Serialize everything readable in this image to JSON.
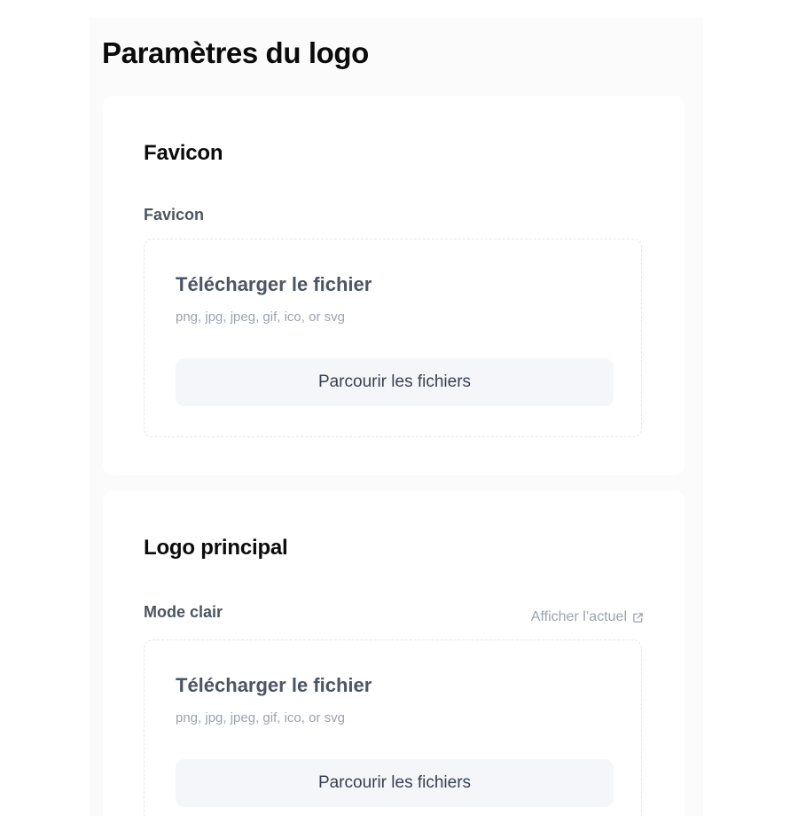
{
  "page": {
    "title": "Paramètres du logo"
  },
  "favicon_section": {
    "title": "Favicon",
    "field_label": "Favicon",
    "upload": {
      "title": "Télécharger le fichier",
      "hint": "png, jpg, jpeg, gif, ico, or svg",
      "browse_label": "Parcourir les fichiers"
    }
  },
  "main_logo_section": {
    "title": "Logo principal",
    "field_label": "Mode clair",
    "view_current_label": "Afficher l’actuel",
    "view_current_icon": "external-link-icon",
    "upload": {
      "title": "Télécharger le fichier",
      "hint": "png, jpg, jpeg, gif, ico, or svg",
      "browse_label": "Parcourir les fichiers"
    }
  }
}
